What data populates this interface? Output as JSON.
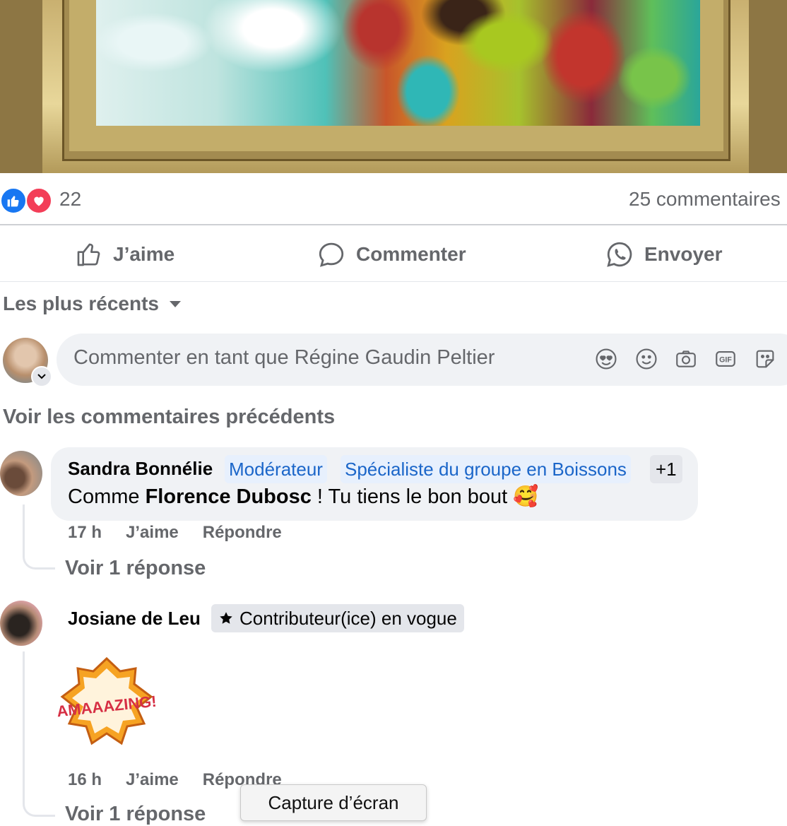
{
  "reactions": {
    "count": "22",
    "comments_count": "25 commentaires"
  },
  "actions": {
    "like": "J’aime",
    "comment": "Commenter",
    "send": "Envoyer"
  },
  "sort": {
    "label": "Les plus récents"
  },
  "composer": {
    "placeholder": "Commenter en tant que Régine Gaudin Peltier"
  },
  "previous_comments": "Voir les commentaires précédents",
  "comments": [
    {
      "author": "Sandra Bonnélie",
      "badges": [
        "Modérateur",
        "Spécialiste du groupe en Boissons",
        "+1"
      ],
      "text_before": "Comme ",
      "mention": "Florence Dubosc",
      "text_after": " ! Tu tiens le bon bout 🥰",
      "time": "17 h",
      "like": "J’aime",
      "reply": "Répondre",
      "replies": "Voir 1 réponse"
    },
    {
      "author": "Josiane de Leu",
      "badge": "Contributeur(ice) en vogue",
      "sticker_text": "AMAAAZING!",
      "time": "16 h",
      "like": "J’aime",
      "reply": "Répondre",
      "replies": "Voir 1 réponse"
    }
  ],
  "tooltip": "Capture d’écran",
  "colors": {
    "like_blue": "#1877f2",
    "love_red": "#f33e58",
    "muted_text": "#65676b",
    "bubble_bg": "#f0f2f5",
    "badge_blue": "#1b66c9"
  },
  "icons": [
    "like-reaction-icon",
    "love-reaction-icon",
    "thumbs-up-icon",
    "comment-bubble-icon",
    "whatsapp-icon",
    "caret-down-icon",
    "avatar-icon",
    "heart-eyes-face-icon",
    "smiley-icon",
    "camera-icon",
    "gif-icon",
    "sticker-icon",
    "star-icon"
  ]
}
